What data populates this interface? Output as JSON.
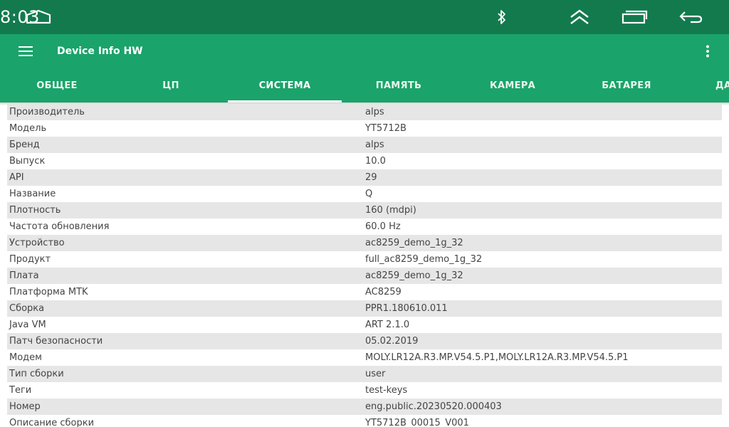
{
  "status_bar": {
    "time": "8:03",
    "icons": [
      "home-icon",
      "bluetooth-icon",
      "expand-up-icon",
      "recent-apps-icon",
      "back-icon"
    ]
  },
  "app_bar": {
    "title": "Device Info HW",
    "icons": [
      "menu-icon",
      "more-vert-icon"
    ],
    "color": "#1aa36a",
    "status_color": "#137a4e"
  },
  "tabs": [
    {
      "label": "ОБЩЕЕ"
    },
    {
      "label": "ЦП"
    },
    {
      "label": "СИСТЕМА",
      "active": true
    },
    {
      "label": "ПАМЯТЬ"
    },
    {
      "label": "КАМЕРА"
    },
    {
      "label": "БАТАРЕЯ"
    },
    {
      "label": "ДА"
    }
  ],
  "rows": [
    {
      "key": "Производитель",
      "value": "alps"
    },
    {
      "key": "Модель",
      "value": "YT5712B"
    },
    {
      "key": "Бренд",
      "value": "alps"
    },
    {
      "key": "Выпуск",
      "value": "10.0"
    },
    {
      "key": "API",
      "value": "29"
    },
    {
      "key": "Название",
      "value": "Q"
    },
    {
      "key": "Плотность",
      "value": "160 (mdpi)"
    },
    {
      "key": "Частота обновления",
      "value": "60.0 Hz"
    },
    {
      "key": "Устройство",
      "value": "ac8259_demo_1g_32"
    },
    {
      "key": "Продукт",
      "value": "full_ac8259_demo_1g_32"
    },
    {
      "key": "Плата",
      "value": "ac8259_demo_1g_32"
    },
    {
      "key": "Платформа MTK",
      "value": "AC8259"
    },
    {
      "key": "Сборка",
      "value": "PPR1.180610.011"
    },
    {
      "key": "Java VM",
      "value": "ART 2.1.0"
    },
    {
      "key": "Патч безопасности",
      "value": "05.02.2019"
    },
    {
      "key": "Модем",
      "value": "MOLY.LR12A.R3.MP.V54.5.P1,MOLY.LR12A.R3.MP.V54.5.P1"
    },
    {
      "key": "Тип сборки",
      "value": "user"
    },
    {
      "key": "Теги",
      "value": "test-keys"
    },
    {
      "key": "Номер",
      "value": "eng.public.20230520.000403"
    },
    {
      "key": "Описание сборки",
      "value": "YT5712B_00015_V001"
    }
  ]
}
